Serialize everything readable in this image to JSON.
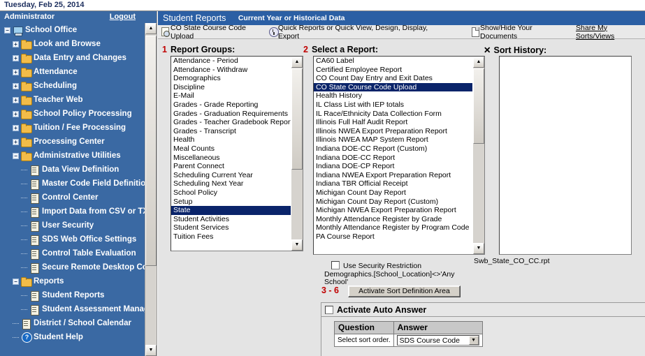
{
  "datebar": {
    "text": "Tuesday, Feb 25, 2014"
  },
  "sidebar": {
    "user": "Administrator",
    "logout": "Logout",
    "tree": [
      {
        "label": "School Office",
        "level": 0,
        "icon": "computer-icon",
        "expander": "minus"
      },
      {
        "label": "Look and Browse",
        "level": 1,
        "icon": "folder-icon",
        "expander": "plus"
      },
      {
        "label": "Data Entry and Changes",
        "level": 1,
        "icon": "folder-icon",
        "expander": "plus"
      },
      {
        "label": "Attendance",
        "level": 1,
        "icon": "folder-icon",
        "expander": "plus"
      },
      {
        "label": "Scheduling",
        "level": 1,
        "icon": "folder-icon",
        "expander": "plus"
      },
      {
        "label": "Teacher Web",
        "level": 1,
        "icon": "folder-icon",
        "expander": "plus"
      },
      {
        "label": "School Policy Processing",
        "level": 1,
        "icon": "folder-icon",
        "expander": "plus"
      },
      {
        "label": "Tuition / Fee Processing",
        "level": 1,
        "icon": "folder-icon",
        "expander": "plus"
      },
      {
        "label": "Processing Center",
        "level": 1,
        "icon": "folder-icon",
        "expander": "plus"
      },
      {
        "label": "Administrative Utilities",
        "level": 1,
        "icon": "folder-icon",
        "expander": "minus"
      },
      {
        "label": "Data View Definition",
        "level": 2,
        "icon": "document-icon",
        "expander": "leaf"
      },
      {
        "label": "Master Code Field Definition",
        "level": 2,
        "icon": "document-icon",
        "expander": "leaf"
      },
      {
        "label": "Control Center",
        "level": 2,
        "icon": "document-icon",
        "expander": "leaf"
      },
      {
        "label": "Import Data from CSV or TXT",
        "level": 2,
        "icon": "document-icon",
        "expander": "leaf"
      },
      {
        "label": "User Security",
        "level": 2,
        "icon": "document-icon",
        "expander": "leaf"
      },
      {
        "label": "SDS Web Office Settings",
        "level": 2,
        "icon": "document-icon",
        "expander": "leaf"
      },
      {
        "label": "Control Table Evaluation",
        "level": 2,
        "icon": "document-icon",
        "expander": "leaf"
      },
      {
        "label": "Secure Remote Desktop Conn",
        "level": 2,
        "icon": "document-icon",
        "expander": "leaf"
      },
      {
        "label": "Reports",
        "level": 1,
        "icon": "folder-icon",
        "expander": "minus"
      },
      {
        "label": "Student Reports",
        "level": 2,
        "icon": "document-icon",
        "expander": "leaf"
      },
      {
        "label": "Student Assessment Manag",
        "level": 2,
        "icon": "document-icon",
        "expander": "leaf"
      },
      {
        "label": "District / School Calendar",
        "level": 1,
        "icon": "document-icon",
        "expander": "leaf"
      },
      {
        "label": "Student Help",
        "level": 1,
        "icon": "help-icon",
        "expander": "leaf"
      }
    ]
  },
  "main": {
    "title": "Student Reports",
    "subtitle": "Current Year or Historical Data",
    "toolbar": {
      "upload_label": "CO State Course Code Upload",
      "quick_label": "Quick Reports or Quick View, Design, Display, Export",
      "documents_label": "Show/Hide Your Documents",
      "share_label": "Share My Sorts/Views"
    },
    "report_groups": {
      "step": "1",
      "label": "Report Groups:",
      "selected": "State",
      "items": [
        "Attendance - Period",
        "Attendance - Withdraw",
        "Demographics",
        "Discipline",
        "E-Mail",
        "Grades - Grade Reporting",
        "Grades - Graduation Requirements",
        "Grades - Teacher Gradebook Report",
        "Grades - Transcript",
        "Health",
        "Meal Counts",
        "Miscellaneous",
        "Parent Connect",
        "Scheduling Current Year",
        "Scheduling Next Year",
        "School Policy",
        "Setup",
        "State",
        "Student Activities",
        "Student Services",
        "Tuition Fees"
      ]
    },
    "select_report": {
      "step": "2",
      "label": "Select a Report:",
      "selected": "CO State Course Code Upload",
      "items": [
        "CA60 Label",
        "Certified Employee Report",
        "CO Count Day Entry and Exit Dates",
        "CO State Course Code Upload",
        "Health History",
        "IL Class List with IEP totals",
        "IL Race/Ethnicity Data Collection Form",
        "Illinois Full Half Audit Report",
        "Illinois NWEA Export Preparation Report",
        "Illinois NWEA MAP System Report",
        "Indiana DOE-CC Report (Custom)",
        "Indiana DOE-CC Report",
        "Indiana DOE-CP Report",
        "Indiana NWEA Export Preparation Report",
        "Indiana TBR Official Receipt",
        "Michigan Count Day Report",
        "Michigan Count Day Report (Custom)",
        "Michigan NWEA Export Preparation Report",
        "Monthly Attendance Register by Grade",
        "Monthly Attendance Register by Program Code",
        "PA Course Report"
      ],
      "report_file": "Swb_State_CO_CC.rpt"
    },
    "sort_history": {
      "icon": "x-mark-icon",
      "label": "Sort History:",
      "items": []
    },
    "security_restriction": {
      "label": "Use Security Restriction",
      "checked": false,
      "filter_text": "Demographics.[School_Location]<>'Any School'"
    },
    "activate_sort": {
      "step": "3 - 6",
      "button_label": "Activate Sort Definition Area"
    },
    "auto_answer": {
      "label": "Activate Auto Answer",
      "checked": false,
      "columns": [
        "Question",
        "Answer"
      ],
      "rows": [
        {
          "question": "Select sort order.",
          "answer": "SDS Course Code"
        }
      ]
    }
  }
}
